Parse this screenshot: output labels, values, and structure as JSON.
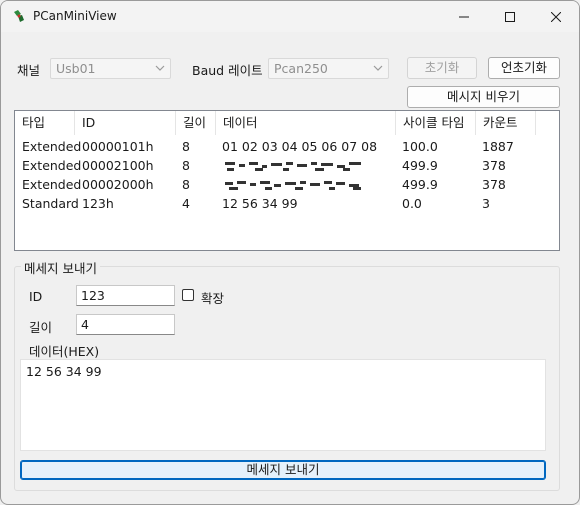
{
  "window": {
    "title": "PCanMiniView"
  },
  "toolbar": {
    "channel_label": "채널",
    "channel_value": "Usb01",
    "baud_label": "Baud 레이트",
    "baud_value": "Pcan250",
    "init_label": "초기화",
    "uninit_label": "언초기화",
    "clear_label": "메시지 비우기"
  },
  "table": {
    "columns": [
      "타입",
      "ID",
      "길이",
      "데이터",
      "사이클 타임",
      "카운트"
    ],
    "rows": [
      {
        "type": "Extended",
        "id": "00000101h",
        "len": "8",
        "data": "01 02 03 04 05 06 07 08",
        "cycle": "100.0",
        "count": "1887"
      },
      {
        "type": "Extended",
        "id": "00002100h",
        "len": "8",
        "data": "",
        "cycle": "499.9",
        "count": "378"
      },
      {
        "type": "Extended",
        "id": "00002000h",
        "len": "8",
        "data": "",
        "cycle": "499.9",
        "count": "378"
      },
      {
        "type": "Standard",
        "id": "123h",
        "len": "4",
        "data": "12 56 34 99",
        "cycle": "0.0",
        "count": "3"
      }
    ]
  },
  "send": {
    "group_title": "메세지 보내기",
    "id_label": "ID",
    "id_value": "123",
    "extended_label": "확장",
    "length_label": "길이",
    "length_value": "4",
    "data_label": "데이터(HEX)",
    "data_value": "12 56 34 99",
    "send_button": "메세지 보내기"
  }
}
